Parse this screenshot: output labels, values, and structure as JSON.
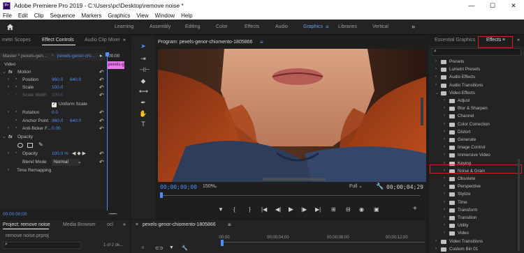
{
  "window": {
    "title": "Adobe Premiere Pro 2019 - C:\\Users\\pc\\Desktop\\remove noise *",
    "app_icon": "Pr",
    "controls": [
      "—",
      "☐",
      "✕"
    ]
  },
  "menu": [
    "File",
    "Edit",
    "Clip",
    "Sequence",
    "Markers",
    "Graphics",
    "View",
    "Window",
    "Help"
  ],
  "workspaces": {
    "tabs": [
      "Learning",
      "Assembly",
      "Editing",
      "Color",
      "Effects",
      "Audio",
      "Graphics",
      "Libraries",
      "Vertical"
    ],
    "active": "Graphics",
    "menu_icon": "≡",
    "overflow": "»"
  },
  "left_panel": {
    "tabs": [
      "metri Scopes",
      "Effect Controls",
      "Audio Clip Mixer"
    ],
    "tab_menu": "≡",
    "overflow": "»",
    "master_label": "Master * pexels-gen...",
    "clip_label": "pexels-genor-chi...",
    "timeline_time": "00:00",
    "clip_chip": "pexels-g",
    "section_video": "Video",
    "fx": "fx",
    "motion": "Motion",
    "position_label": "Position",
    "position_x": "960.0",
    "position_y": "640.0",
    "scale_label": "Scale",
    "scale_value": "100.0",
    "scale_width_label": "Scale Width",
    "scale_width_value": "100.0",
    "uniform_scale": "Uniform Scale",
    "rotation_label": "Rotation",
    "rotation_value": "0.0",
    "anchor_label": "Anchor Point",
    "anchor_x": "960.0",
    "anchor_y": "640.0",
    "antiflicker_label": "Anti-flicker F...",
    "antiflicker_value": "0.00",
    "opacity_section": "Opacity",
    "opacity_label": "Opacity",
    "opacity_value": "100.0 %",
    "blend_label": "Blend Mode",
    "blend_value": "Normal",
    "time_remap": "Time Remapping",
    "bottom_time": "00:00:00;00"
  },
  "program": {
    "title": "Program: pexels-genor-chiomento-1805866",
    "menu_icon": "≡",
    "timecode_current": "00;00;00;00",
    "zoom": "150%",
    "quality": "Full",
    "timecode_duration": "00;00;04;29"
  },
  "effects_panel": {
    "tabs": [
      "Essential Graphics",
      "Effects"
    ],
    "active": "Effects",
    "menu_icon": "≡",
    "overflow": "»",
    "search_icon": "search-icon",
    "items": [
      {
        "label": "Presets",
        "level": 0,
        "open": false
      },
      {
        "label": "Lumetri Presets",
        "level": 0,
        "open": false
      },
      {
        "label": "Audio Effects",
        "level": 0,
        "open": false
      },
      {
        "label": "Audio Transitions",
        "level": 0,
        "open": false
      },
      {
        "label": "Video Effects",
        "level": 0,
        "open": true
      },
      {
        "label": "Adjust",
        "level": 1,
        "open": false
      },
      {
        "label": "Blur & Sharpen",
        "level": 1,
        "open": false
      },
      {
        "label": "Channel",
        "level": 1,
        "open": false
      },
      {
        "label": "Color Correction",
        "level": 1,
        "open": false
      },
      {
        "label": "Distort",
        "level": 1,
        "open": false
      },
      {
        "label": "Generate",
        "level": 1,
        "open": false
      },
      {
        "label": "Image Control",
        "level": 1,
        "open": false
      },
      {
        "label": "Immersive Video",
        "level": 1,
        "open": false
      },
      {
        "label": "Keying",
        "level": 1,
        "open": false
      },
      {
        "label": "Noise & Grain",
        "level": 1,
        "open": false,
        "highlight": true
      },
      {
        "label": "Obsolete",
        "level": 1,
        "open": false
      },
      {
        "label": "Perspective",
        "level": 1,
        "open": false
      },
      {
        "label": "Stylize",
        "level": 1,
        "open": false
      },
      {
        "label": "Time",
        "level": 1,
        "open": false
      },
      {
        "label": "Transform",
        "level": 1,
        "open": false
      },
      {
        "label": "Transition",
        "level": 1,
        "open": false
      },
      {
        "label": "Utility",
        "level": 1,
        "open": false
      },
      {
        "label": "Video",
        "level": 1,
        "open": false
      },
      {
        "label": "Video Transitions",
        "level": 0,
        "open": false
      },
      {
        "label": "Custom Bin 01",
        "level": 0,
        "open": false
      }
    ]
  },
  "project_panel": {
    "tabs": [
      "Project: remove noise",
      "Media Browser",
      "ocl"
    ],
    "overflow": "»",
    "file": "remove noise.prproj",
    "count": "1 of 2 de..."
  },
  "timeline_panel": {
    "tab": "pexels-genor-chiomento-1805866",
    "menu_icon": "≡",
    "time_0": ":00;00",
    "time_1": "00;00;04;00",
    "time_2": "00;00;08;00",
    "time_3": "00;00;12;00"
  },
  "colors": {
    "accent_blue": "#4f8ef7",
    "highlight_red": "#d21f1f",
    "panel_bg": "#232323",
    "dark_bg": "#1d1d1d"
  }
}
